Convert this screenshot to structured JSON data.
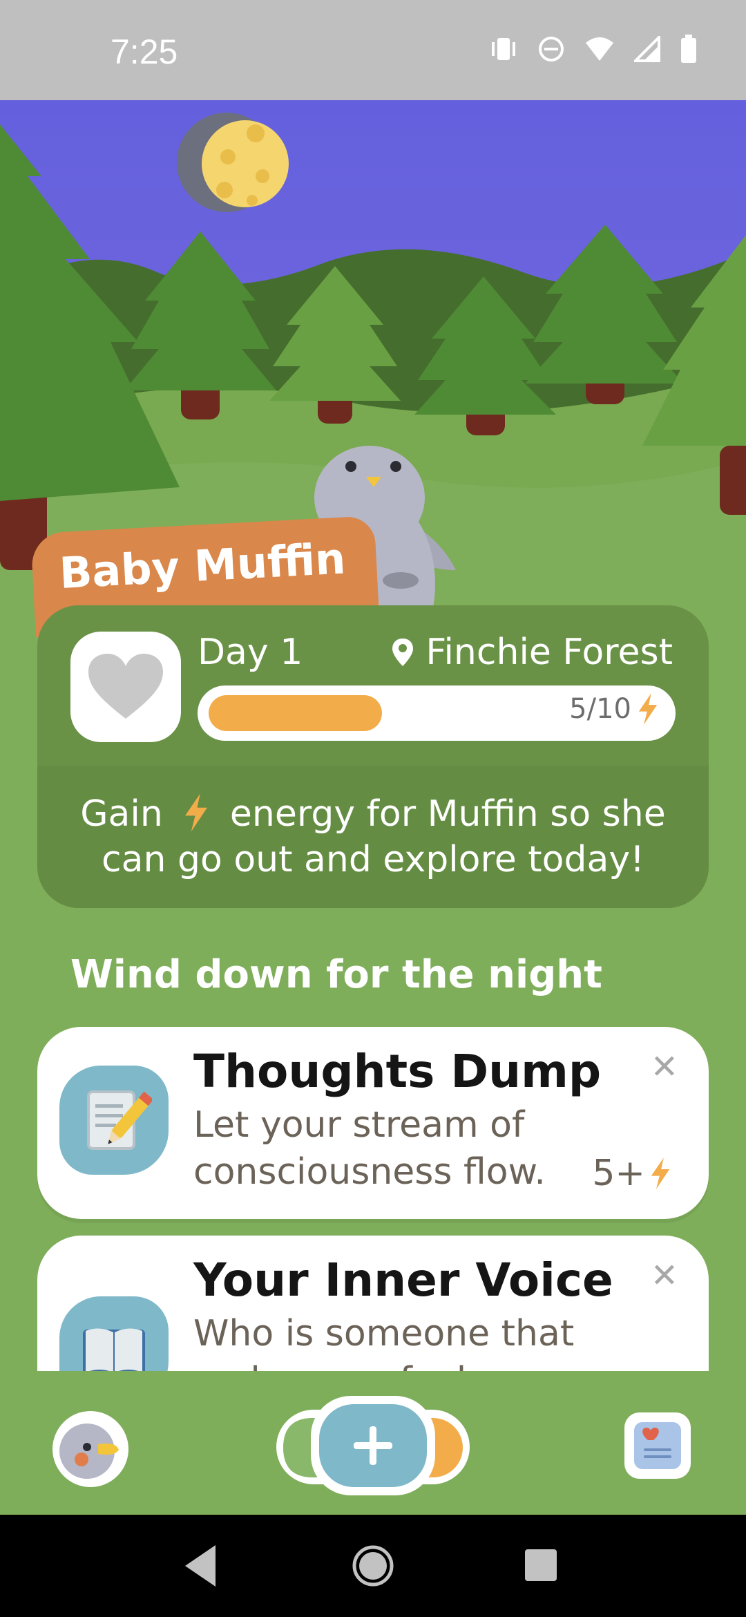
{
  "status_bar": {
    "time": "7:25"
  },
  "pet": {
    "name": "Baby Muffin"
  },
  "status": {
    "day": "Day 1",
    "location": "Finchie Forest",
    "energy_current": 5,
    "energy_max": 10,
    "energy_text": "5/10",
    "energy_fraction": 0.5,
    "message_before": "Gain",
    "message_after": "energy for Muffin so she can go out and explore today!"
  },
  "section": {
    "title": "Wind down for the night"
  },
  "tasks": [
    {
      "title": "Thoughts Dump",
      "description": "Let your stream of consciousness flow.",
      "reward": "5+",
      "icon": "notepad-pencil-icon"
    },
    {
      "title": "Your Inner Voice",
      "description": "Who is someone that makes you feel inspired?",
      "icon": "open-book-icon"
    }
  ],
  "colors": {
    "accent_orange": "#f3ac4a",
    "card_green": "#689046",
    "background_green": "#7fae5a",
    "tag_orange": "#d9874a",
    "sky": "#6a62dc"
  }
}
